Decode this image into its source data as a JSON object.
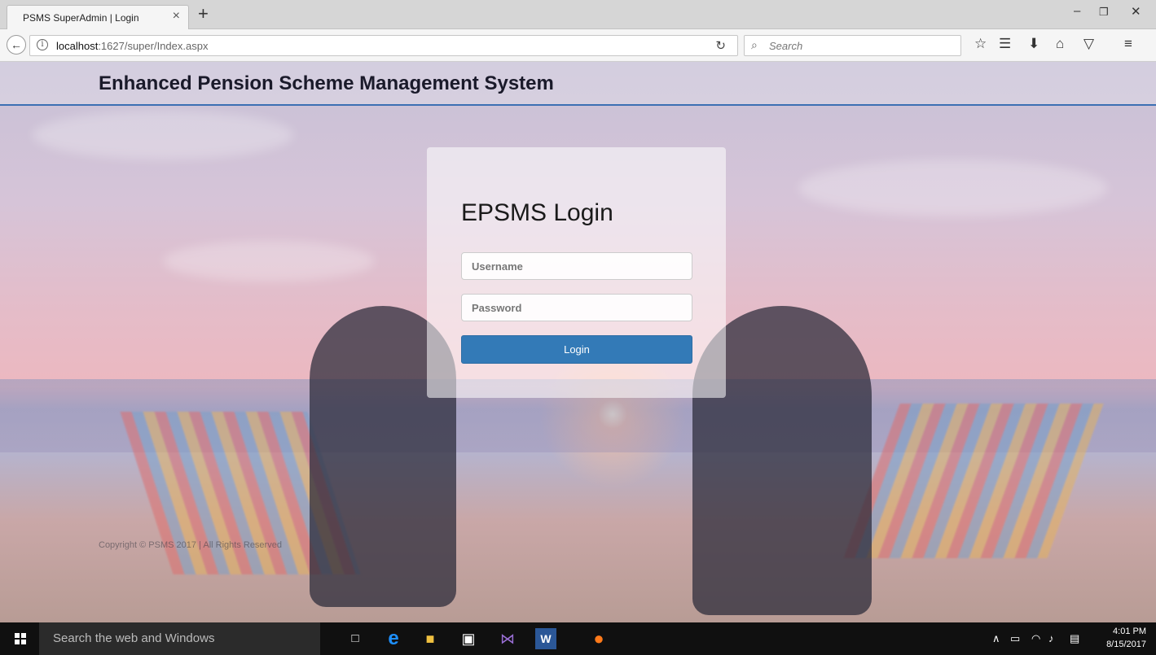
{
  "browser": {
    "tab_title": "PSMS SuperAdmin | Login",
    "url_host": "localhost",
    "url_rest": ":1627/super/Index.aspx",
    "search_placeholder": "Search"
  },
  "page": {
    "header_title": "Enhanced Pension Scheme Management System",
    "login": {
      "title": "EPSMS Login",
      "username_placeholder": "Username",
      "password_placeholder": "Password",
      "button_label": "Login"
    },
    "copyright": "Copyright © PSMS 2017 | All Rights Reserved"
  },
  "taskbar": {
    "search_text": "Search the web and Windows",
    "time": "4:01 PM",
    "date": "8/15/2017"
  },
  "colors": {
    "accent": "#337ab7",
    "header_border": "#3b6fb3"
  }
}
